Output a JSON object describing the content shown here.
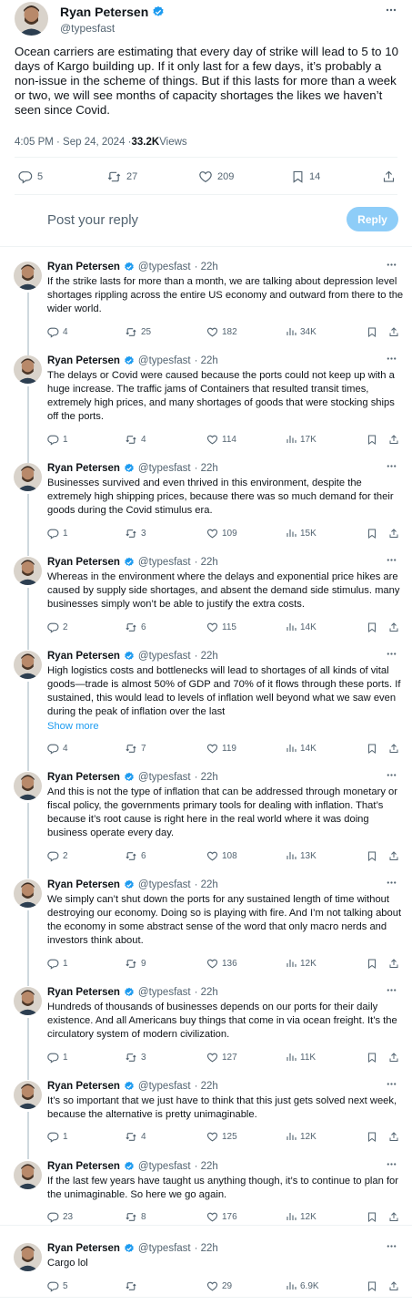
{
  "main_tweet": {
    "author_name": "Ryan Petersen",
    "author_handle": "@typesfast",
    "text": "Ocean carriers are estimating that every day of strike will lead to 5 to 10 days of Kargo building up. If it only last for a few days, it’s probably a non-issue in the scheme of things. But if this lasts for more than a week or two, we will see months of capacity shortages the likes we haven’t seen since Covid.",
    "time": "4:05 PM · Sep 24, 2024 · ",
    "views_count": "33.2K",
    "views_label": " Views",
    "replies": "5",
    "reposts": "27",
    "likes": "209",
    "bookmarks": "14"
  },
  "reply_composer": {
    "placeholder": "Post your reply",
    "button_label": "Reply"
  },
  "colors": {
    "accent": "#1d9bf0",
    "reply_button_disabled": "#8ecdf8",
    "verified": "#1d9bf0",
    "secondary_text": "#536471",
    "thread_line": "#cfd9de"
  },
  "replies": [
    {
      "name": "Ryan Petersen",
      "handle": "@typesfast",
      "time": "· 22h",
      "text": "If the strike lasts for more than a month, we are talking about depression level shortages rippling across the entire US economy and outward from there to the wider world.",
      "show_more": "",
      "replies": "4",
      "reposts": "25",
      "likes": "182",
      "views": "34K"
    },
    {
      "name": "Ryan Petersen",
      "handle": "@typesfast",
      "time": "· 22h",
      "text": "The delays or Covid were caused because the ports could not keep up with a huge increase. The traffic jams of Containers that resulted transit times, extremely high prices, and many shortages of goods that were stocking ships off the ports.",
      "show_more": "",
      "replies": "1",
      "reposts": "4",
      "likes": "114",
      "views": "17K"
    },
    {
      "name": "Ryan Petersen",
      "handle": "@typesfast",
      "time": "· 22h",
      "text": "Businesses survived and even thrived in this environment, despite the extremely high shipping prices, because there was so much demand for their goods during the Covid stimulus era.",
      "show_more": "",
      "replies": "1",
      "reposts": "3",
      "likes": "109",
      "views": "15K"
    },
    {
      "name": "Ryan Petersen",
      "handle": "@typesfast",
      "time": "· 22h",
      "text": "Whereas in the environment where the delays and exponential price hikes are caused by supply side shortages, and absent the demand side stimulus. many businesses simply won’t be able to justify the extra costs.",
      "show_more": "",
      "replies": "2",
      "reposts": "6",
      "likes": "115",
      "views": "14K"
    },
    {
      "name": "Ryan Petersen",
      "handle": "@typesfast",
      "time": "· 22h",
      "text": "High logistics costs and bottlenecks will lead to shortages of all kinds of vital goods—trade is almost 50% of GDP and 70% of it flows through these ports. If sustained, this would lead to levels of inflation well beyond what we saw even during the peak of inflation over the last",
      "show_more": "Show more",
      "replies": "4",
      "reposts": "7",
      "likes": "119",
      "views": "14K"
    },
    {
      "name": "Ryan Petersen",
      "handle": "@typesfast",
      "time": "· 22h",
      "text": "And this is not the type of inflation that can be addressed through monetary or fiscal policy, the governments primary tools for dealing with inflation. That’s because it’s root cause is right here in the real world where it was doing business operate every day.",
      "show_more": "",
      "replies": "2",
      "reposts": "6",
      "likes": "108",
      "views": "13K"
    },
    {
      "name": "Ryan Petersen",
      "handle": "@typesfast",
      "time": "· 22h",
      "text": "We simply can’t shut down the ports for any sustained length of time without destroying our economy. Doing so is playing with fire. And I’m not talking about the economy in some abstract sense of the word that only macro nerds and investors think about.",
      "show_more": "",
      "replies": "1",
      "reposts": "9",
      "likes": "136",
      "views": "12K"
    },
    {
      "name": "Ryan Petersen",
      "handle": "@typesfast",
      "time": "· 22h",
      "text": "Hundreds of thousands of businesses depends on our ports for their daily existence. And all Americans buy things that come in via ocean freight. It’s the circulatory system of modern civilization.",
      "show_more": "",
      "replies": "1",
      "reposts": "3",
      "likes": "127",
      "views": "11K"
    },
    {
      "name": "Ryan Petersen",
      "handle": "@typesfast",
      "time": "· 22h",
      "text": "It’s so important that we just have to think that this just gets solved next week, because the alternative is pretty unimaginable.",
      "show_more": "",
      "replies": "1",
      "reposts": "4",
      "likes": "125",
      "views": "12K"
    },
    {
      "name": "Ryan Petersen",
      "handle": "@typesfast",
      "time": "· 22h",
      "text": "If the last few years have taught us anything though, it’s to continue to plan for the unimaginable. So here we go again.",
      "show_more": "",
      "replies": "23",
      "reposts": "8",
      "likes": "176",
      "views": "12K"
    },
    {
      "name": "Ryan Petersen",
      "handle": "@typesfast",
      "time": "· 22h",
      "text": "Cargo lol",
      "show_more": "",
      "replies": "5",
      "reposts": "",
      "likes": "29",
      "views": "6.9K"
    }
  ]
}
